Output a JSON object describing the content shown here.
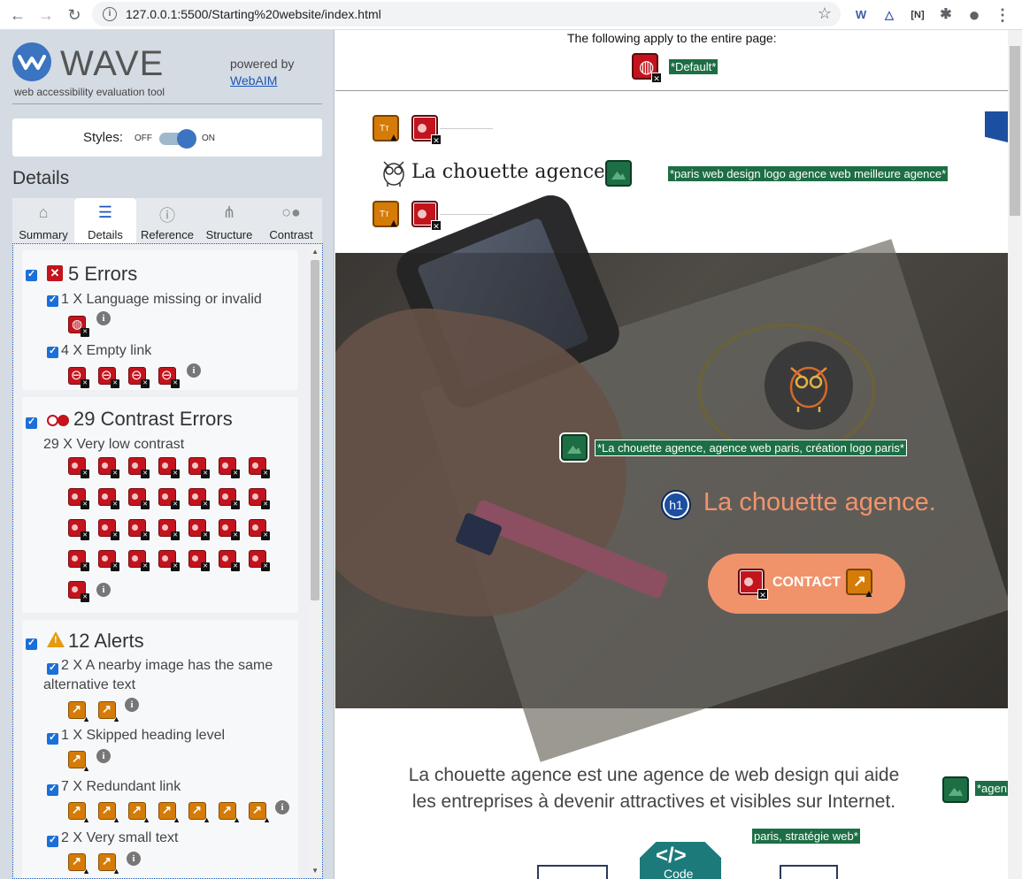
{
  "browser": {
    "url": "127.0.0.1:5500/Starting%20website/index.html",
    "nav": {
      "back": "←",
      "forward": "→",
      "reload": "↻"
    },
    "info_glyph": "i",
    "bookmark_glyph": "☆",
    "extensions": [
      {
        "name": "wave-extension-icon",
        "glyph": "W"
      },
      {
        "name": "triangle-extension-icon",
        "glyph": "△"
      },
      {
        "name": "bracket-extension-icon",
        "glyph": "[N]"
      },
      {
        "name": "puzzle-extension-icon",
        "glyph": "✱"
      },
      {
        "name": "profile-icon",
        "glyph": "●"
      },
      {
        "name": "menu-kebab-icon",
        "glyph": "⋮"
      }
    ]
  },
  "wave": {
    "title": "WAVE",
    "subtitle": "web accessibility evaluation tool",
    "powered_by": "powered by",
    "webaim_link": "WebAIM",
    "styles_label": "Styles:",
    "styles_off": "OFF",
    "styles_on": "ON",
    "details_heading": "Details",
    "tabs": [
      {
        "label": "Summary",
        "icon": "⌂"
      },
      {
        "label": "Details",
        "icon": "☰"
      },
      {
        "label": "Reference",
        "icon": "ⓘ"
      },
      {
        "label": "Structure",
        "icon": "⋔"
      },
      {
        "label": "Contrast",
        "icon": "○●"
      }
    ],
    "errors": {
      "title": "5 Errors",
      "items": [
        {
          "text": "1 X Language missing or invalid",
          "count": 1
        },
        {
          "text": "4 X Empty link",
          "count": 4
        }
      ]
    },
    "contrast": {
      "title": "29 Contrast Errors",
      "items": [
        {
          "text": "29 X Very low contrast",
          "count": 29
        }
      ]
    },
    "alerts": {
      "title": "12 Alerts",
      "items": [
        {
          "text": "2 X A nearby image has the same alternative text",
          "count": 2
        },
        {
          "text": "1 X Skipped heading level",
          "count": 1
        },
        {
          "text": "7 X Redundant link",
          "count": 7
        },
        {
          "text": "2 X Very small text",
          "count": 2
        }
      ]
    }
  },
  "page": {
    "apply_text": "The following apply to the entire page:",
    "default_label": "*Default*",
    "logo_alt": "*paris web design logo agence web meilleure agence*",
    "logo_text": "La chouette agence",
    "hero_alt": "*La chouette agence, agence web paris, création logo paris*",
    "h1_badge": "h1",
    "hero_title": "La chouette agence.",
    "contact_label": "CONTACT",
    "intro_line1": "La chouette agence est une agence de web design qui aide",
    "intro_line2": "les entreprises à devenir attractives et visibles sur Internet.",
    "alt_agen": "*agen",
    "alt_strategy": "paris, stratégie web*",
    "code_glyph": "</>",
    "code_label": "Code",
    "tt_glyph": "Tт"
  },
  "colors": {
    "wave_blue": "#3b74c0",
    "error_red": "#c3131d",
    "alert_orange": "#d57b08",
    "feature_green": "#1d6e45",
    "hero_accent": "#f0936b"
  }
}
